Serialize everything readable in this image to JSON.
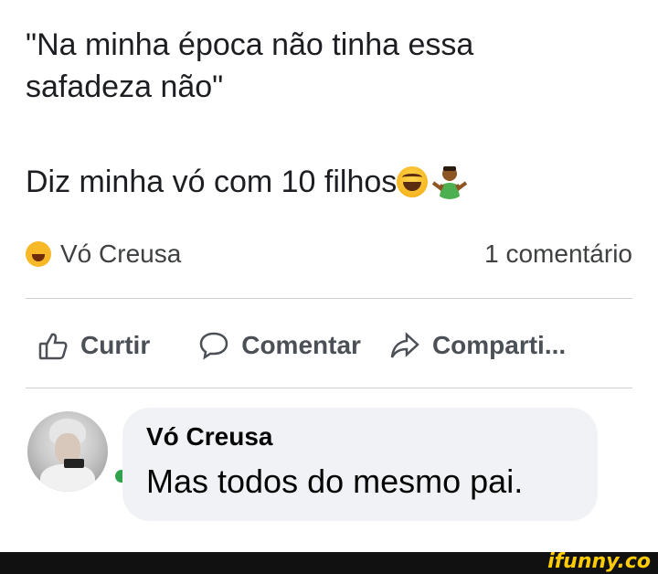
{
  "post": {
    "line1": "\"Na minha época não tinha essa",
    "line1b": "safadeza não\"",
    "line2": "Diz minha vó com 10 filhos"
  },
  "stats": {
    "reaction_name": "Vó Creusa",
    "comments": "1 comentário"
  },
  "actions": {
    "like": "Curtir",
    "comment": "Comentar",
    "share": "Comparti..."
  },
  "comment": {
    "author": "Vó Creusa",
    "text": "Mas todos do mesmo pai."
  },
  "watermark": "ifunny.co",
  "colors": {
    "online": "#31a24c",
    "bubble": "#f0f2f5",
    "watermark": "#ffcc00"
  }
}
